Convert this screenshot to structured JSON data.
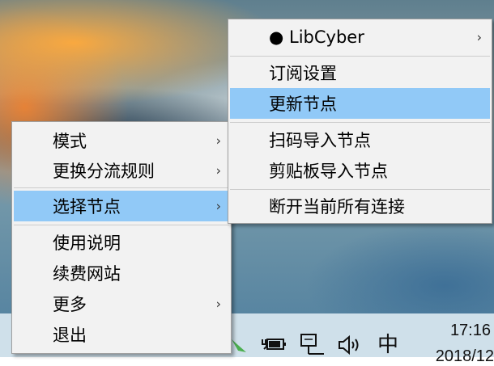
{
  "main_menu": {
    "items": [
      {
        "label": "模式",
        "has_submenu": true
      },
      {
        "label": "更换分流规则",
        "has_submenu": true
      },
      {
        "label": "选择节点",
        "has_submenu": true,
        "highlighted": true
      },
      {
        "label": "使用说明",
        "has_submenu": false
      },
      {
        "label": "续费网站",
        "has_submenu": false
      },
      {
        "label": "更多",
        "has_submenu": true
      },
      {
        "label": "退出",
        "has_submenu": false
      }
    ],
    "arrow_glyph": "›"
  },
  "sub_menu": {
    "selected_node": "● LibCyber",
    "items": [
      {
        "label": "订阅设置"
      },
      {
        "label": "更新节点",
        "highlighted": true
      },
      {
        "label": "扫码导入节点"
      },
      {
        "label": "剪贴板导入节点"
      },
      {
        "label": "断开当前所有连接"
      }
    ]
  },
  "taskbar": {
    "time": "17:16",
    "date": "2018/12",
    "ime": "中",
    "icons": [
      "app-tray-icon",
      "power-icon",
      "network-icon",
      "volume-icon"
    ]
  },
  "colors": {
    "highlight": "#91c9f7",
    "menu_bg": "#f2f2f2",
    "taskbar": "#cfe0ea"
  }
}
